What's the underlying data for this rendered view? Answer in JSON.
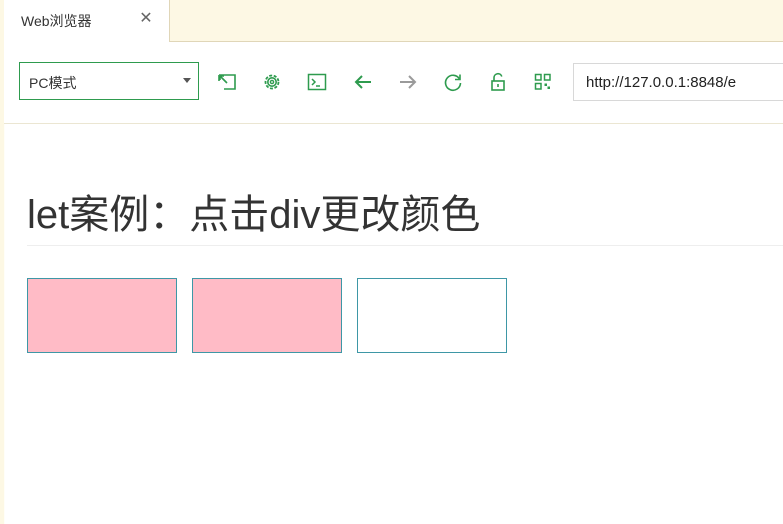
{
  "browser": {
    "tab_title": "Web浏览器",
    "tab_close_symbol": "✕",
    "mode_select": {
      "selected": "PC模式"
    },
    "toolbar_icons": [
      "screenshot-icon",
      "settings-icon",
      "console-icon",
      "back-icon",
      "forward-icon",
      "refresh-icon",
      "lock-icon",
      "qrcode-icon"
    ],
    "url": "http://127.0.0.1:8848/e",
    "accent_color": "#2e9b4e"
  },
  "page": {
    "title": "let案例：点击div更改颜色",
    "boxes": [
      {
        "background": "#ffbbc6"
      },
      {
        "background": "#ffbbc6"
      },
      {
        "background": "#ffffff"
      }
    ],
    "box_border_color": "#3e97a6"
  }
}
